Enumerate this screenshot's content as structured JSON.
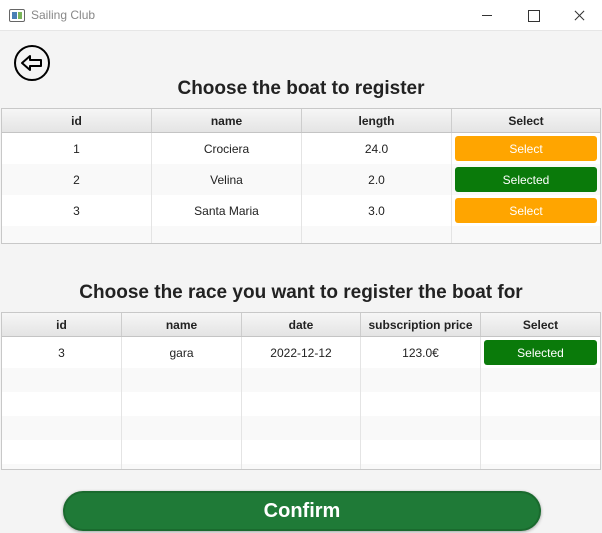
{
  "window": {
    "title": "Sailing Club"
  },
  "boats": {
    "heading": "Choose the boat to register",
    "columns": [
      "id",
      "name",
      "length",
      "Select"
    ],
    "rows": [
      {
        "id": "1",
        "name": "Crociera",
        "length": "24.0",
        "select": "Select",
        "selected": false
      },
      {
        "id": "2",
        "name": "Velina",
        "length": "2.0",
        "select": "Selected",
        "selected": true
      },
      {
        "id": "3",
        "name": "Santa Maria",
        "length": "3.0",
        "select": "Select",
        "selected": false
      }
    ]
  },
  "races": {
    "heading": "Choose the race you want to register the boat for",
    "columns": [
      "id",
      "name",
      "date",
      "subscription price",
      "Select"
    ],
    "rows": [
      {
        "id": "3",
        "name": "gara",
        "date": "2022-12-12",
        "price": "123.0€",
        "select": "Selected",
        "selected": true
      }
    ]
  },
  "confirm_label": "Confirm",
  "colors": {
    "select_button": "#ffa500",
    "selected_button": "#0a7a0a",
    "confirm_button": "#1f7a37"
  },
  "icons": {
    "back": "back-arrow-circle-icon"
  }
}
